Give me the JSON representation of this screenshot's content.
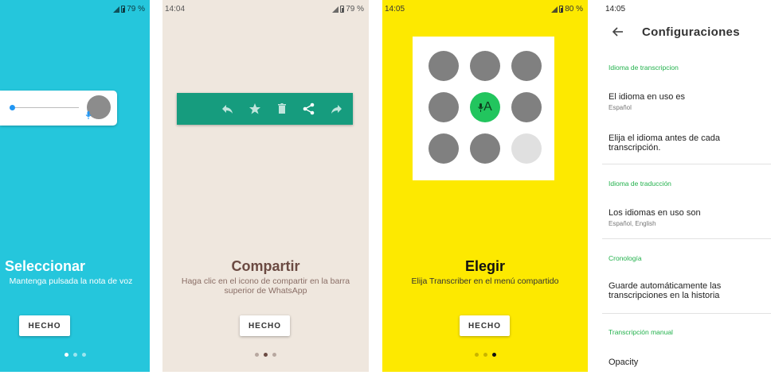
{
  "screens": [
    {
      "status": {
        "time": "",
        "battery": "79 %"
      },
      "title": "Seleccionar",
      "description": "Mantenga pulsada la nota de voz",
      "button": "HECHO",
      "page_indicator": {
        "count": 3,
        "active": 0
      }
    },
    {
      "status": {
        "time": "14:04",
        "battery": "79 %"
      },
      "title": "Compartir",
      "description": "Haga clic en el icono de compartir en la barra superior de WhatsApp",
      "button": "HECHO",
      "page_indicator": {
        "count": 3,
        "active": 1
      }
    },
    {
      "status": {
        "time": "14:05",
        "battery": "80 %"
      },
      "title": "Elegir",
      "description": "Elija Transcriber en el menú compartido",
      "button": "HECHO",
      "page_indicator": {
        "count": 3,
        "active": 2
      },
      "app_label": "A"
    },
    {
      "status": {
        "time": "14:05"
      },
      "header_title": "Configuraciones",
      "sections": [
        {
          "label": "Idioma de transcripcion",
          "items": [
            {
              "title": "El idioma en uso es",
              "subtitle": "Español"
            },
            {
              "title": "Elija el idioma antes de cada transcripción.",
              "subtitle": ""
            }
          ]
        },
        {
          "label": "Idioma de traducción",
          "items": [
            {
              "title": "Los idiomas en uso son",
              "subtitle": "Español, English"
            }
          ]
        },
        {
          "label": "Cronología",
          "items": [
            {
              "title": "Guarde automáticamente las transcripciones en la historia",
              "subtitle": ""
            }
          ]
        },
        {
          "label": "Transcripción manual",
          "items": [
            {
              "title": "Opacity",
              "subtitle": ""
            }
          ]
        }
      ]
    }
  ],
  "colors": {
    "screen1_bg": "#25c6dc",
    "screen2_bg": "#efe7de",
    "screen3_bg": "#fde900",
    "whatsapp_green": "#169c7e",
    "section_green": "#22b14c"
  },
  "icons": [
    "signal-icon",
    "battery-icon",
    "microphone-icon",
    "reply-icon",
    "star-icon",
    "delete-icon",
    "share-icon",
    "forward-icon",
    "back-arrow-icon"
  ]
}
